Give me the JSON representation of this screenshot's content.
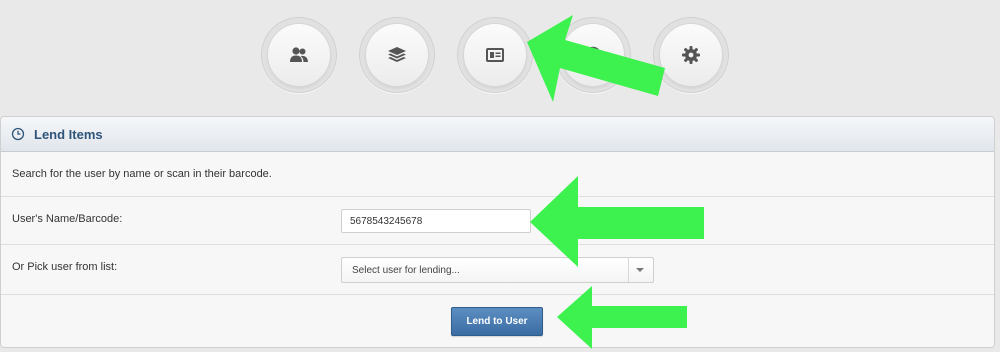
{
  "nav": {
    "buttons": [
      {
        "name": "users",
        "icon": "users-icon"
      },
      {
        "name": "items",
        "icon": "layers-icon"
      },
      {
        "name": "lend",
        "icon": "id-card-icon"
      },
      {
        "name": "history",
        "icon": "history-icon"
      },
      {
        "name": "settings",
        "icon": "gear-icon"
      }
    ]
  },
  "panel": {
    "title": "Lend Items",
    "intro": "Search for the user by name or scan in their barcode.",
    "user_label": "User's Name/Barcode:",
    "user_value": "5678543245678",
    "pick_label": "Or Pick user from list:",
    "pick_placeholder": "Select user for lending...",
    "lend_button": "Lend to User"
  },
  "colors": {
    "accent": "#3b6da3",
    "title": "#2f5479",
    "arrow": "#3df24f"
  }
}
